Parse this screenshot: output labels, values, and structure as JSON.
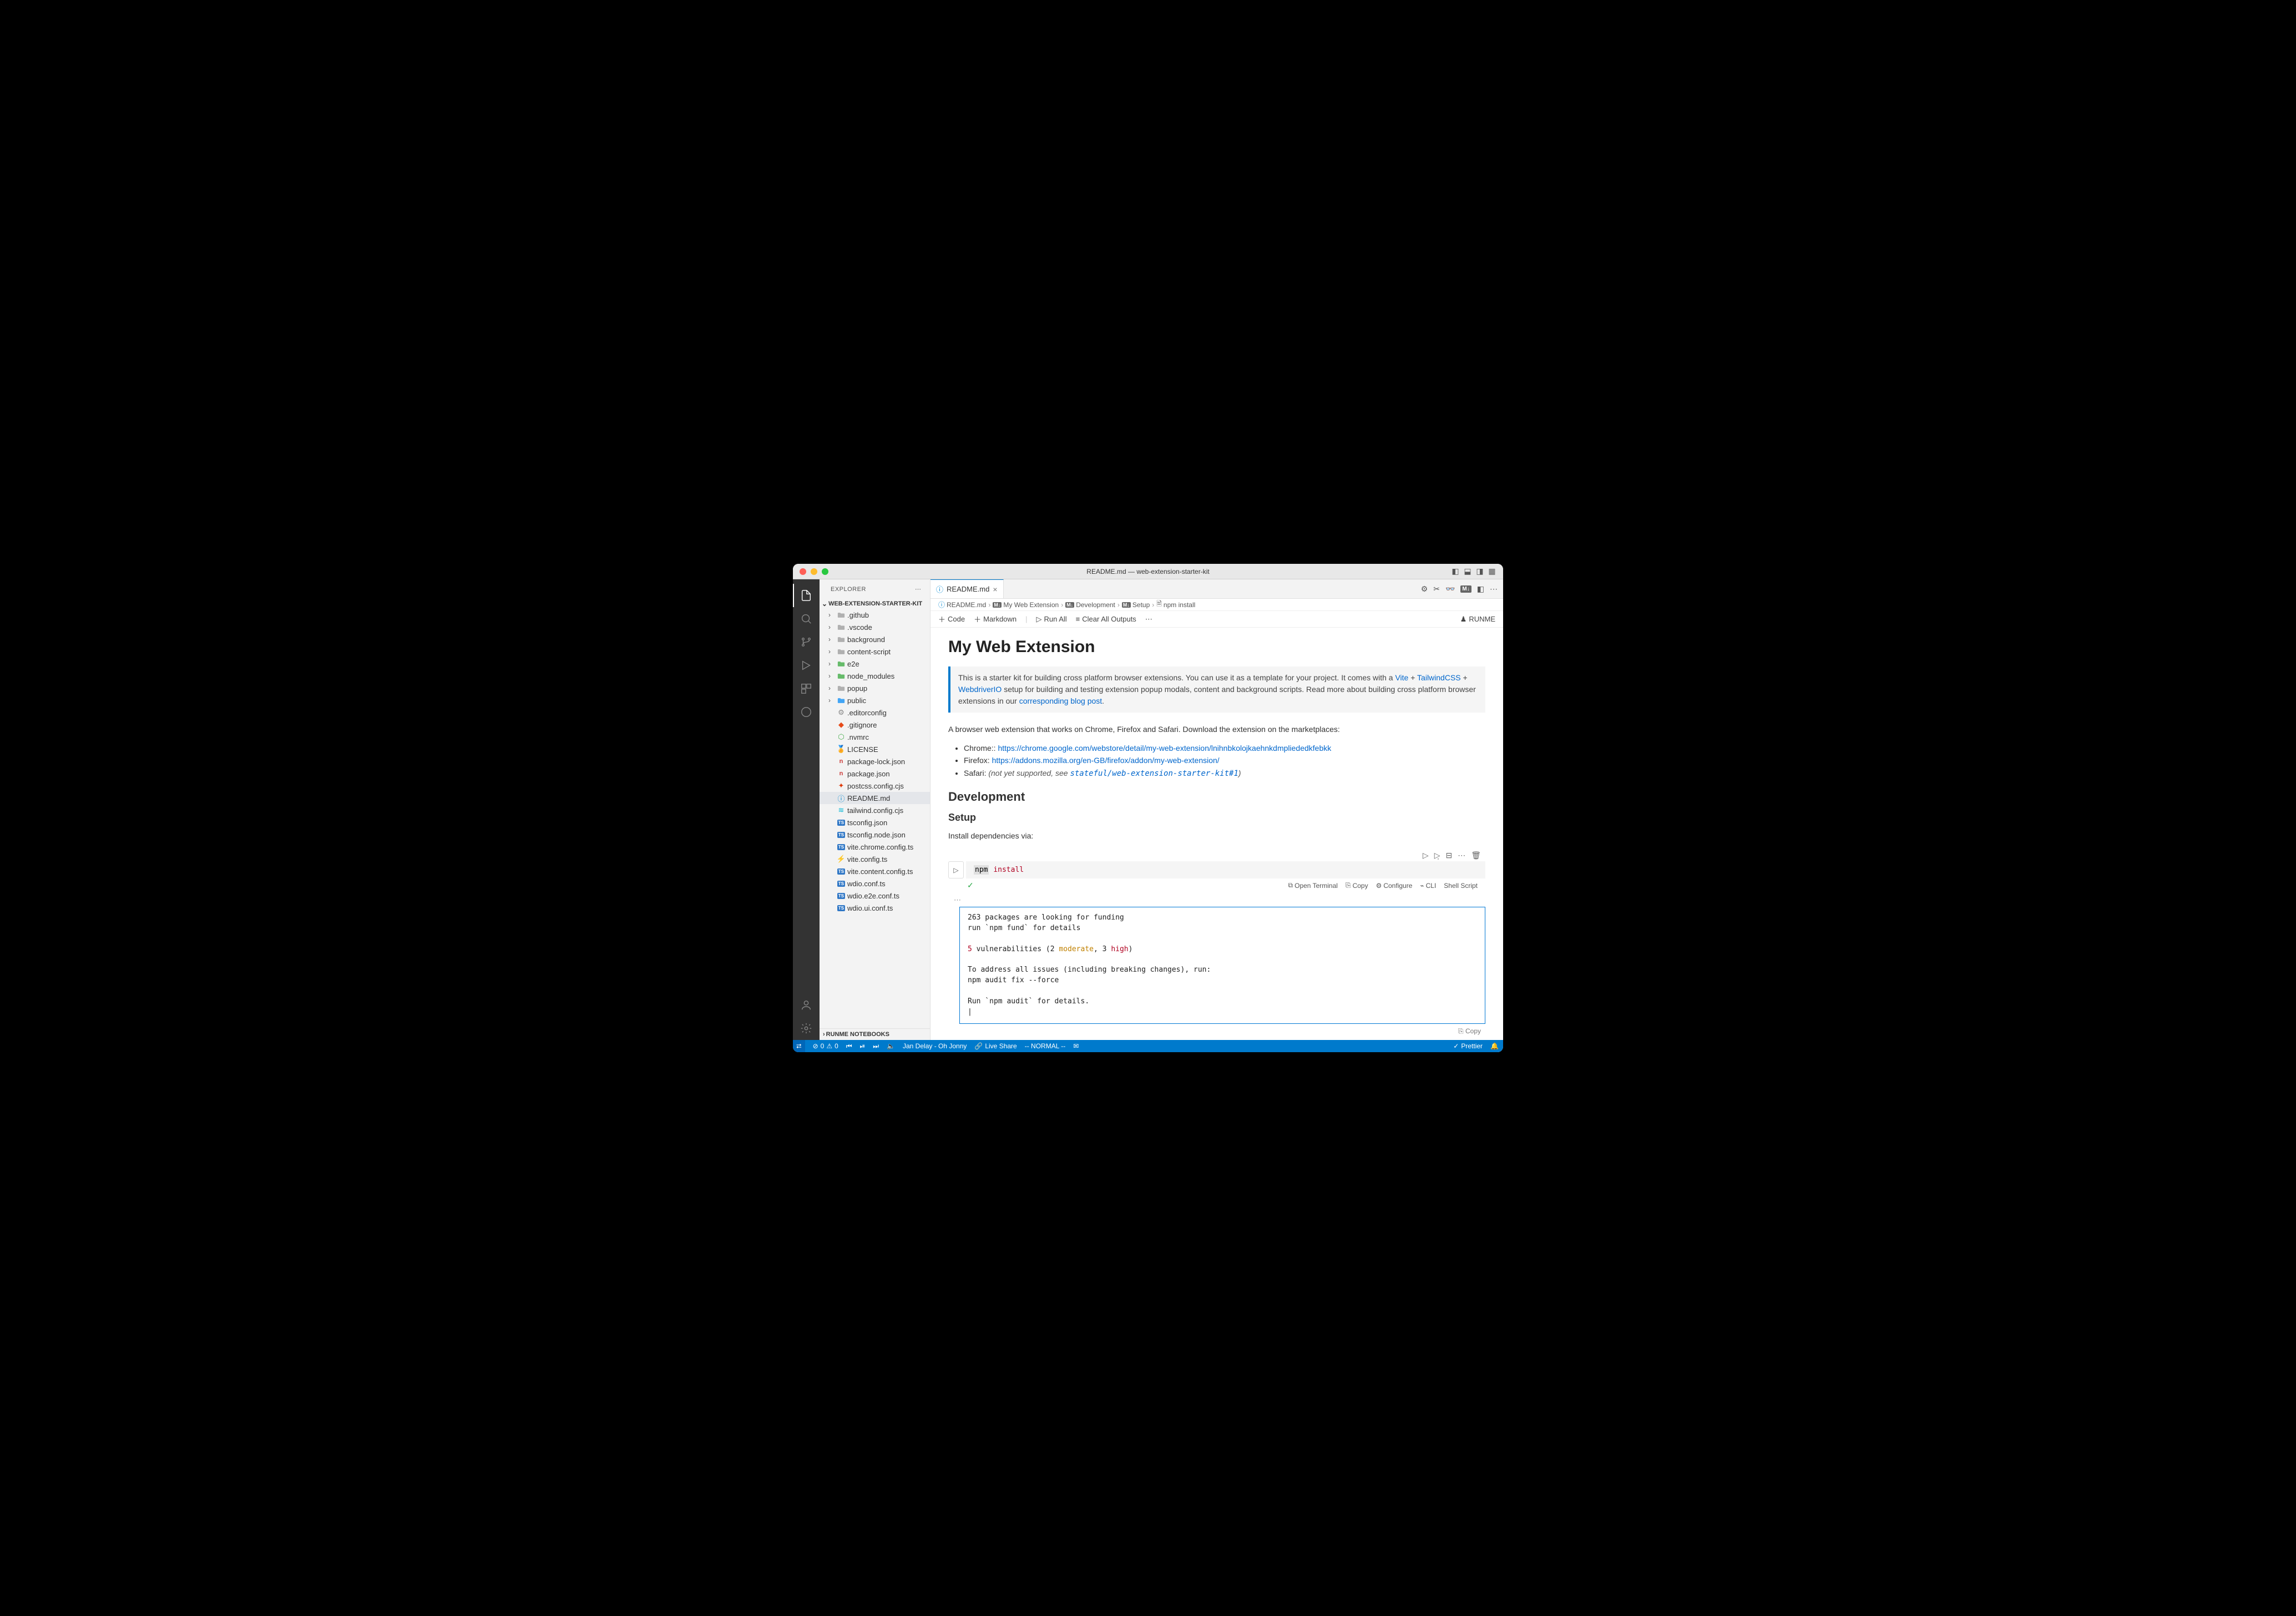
{
  "window": {
    "title": "README.md — web-extension-starter-kit"
  },
  "sidebar": {
    "title": "EXPLORER",
    "project": "WEB-EXTENSION-STARTER-KIT",
    "footer": "RUNME NOTEBOOKS",
    "tree": [
      {
        "type": "folder",
        "label": ".github",
        "color": "#b0b0b0"
      },
      {
        "type": "folder",
        "label": ".vscode",
        "color": "#b0b0b0"
      },
      {
        "type": "folder",
        "label": "background",
        "color": "#b0b0b0"
      },
      {
        "type": "folder",
        "label": "content-script",
        "color": "#b0b0b0"
      },
      {
        "type": "folder",
        "label": "e2e",
        "color": "#66bb6a"
      },
      {
        "type": "folder",
        "label": "node_modules",
        "color": "#66bb6a"
      },
      {
        "type": "folder",
        "label": "popup",
        "color": "#b0b0b0"
      },
      {
        "type": "folder",
        "label": "public",
        "color": "#42a5f5"
      },
      {
        "type": "file",
        "label": ".editorconfig",
        "icon": "gear"
      },
      {
        "type": "file",
        "label": ".gitignore",
        "icon": "git"
      },
      {
        "type": "file",
        "label": ".nvmrc",
        "icon": "hex"
      },
      {
        "type": "file",
        "label": "LICENSE",
        "icon": "cert"
      },
      {
        "type": "file",
        "label": "package-lock.json",
        "icon": "npm"
      },
      {
        "type": "file",
        "label": "package.json",
        "icon": "npm"
      },
      {
        "type": "file",
        "label": "postcss.config.cjs",
        "icon": "postcss"
      },
      {
        "type": "file",
        "label": "README.md",
        "icon": "info",
        "selected": true
      },
      {
        "type": "file",
        "label": "tailwind.config.cjs",
        "icon": "tw"
      },
      {
        "type": "file",
        "label": "tsconfig.json",
        "icon": "ts"
      },
      {
        "type": "file",
        "label": "tsconfig.node.json",
        "icon": "ts"
      },
      {
        "type": "file",
        "label": "vite.chrome.config.ts",
        "icon": "ts"
      },
      {
        "type": "file",
        "label": "vite.config.ts",
        "icon": "vite"
      },
      {
        "type": "file",
        "label": "vite.content.config.ts",
        "icon": "ts"
      },
      {
        "type": "file",
        "label": "wdio.conf.ts",
        "icon": "ts"
      },
      {
        "type": "file",
        "label": "wdio.e2e.conf.ts",
        "icon": "ts"
      },
      {
        "type": "file",
        "label": "wdio.ui.conf.ts",
        "icon": "ts"
      }
    ]
  },
  "tab": {
    "label": "README.md"
  },
  "tabs_right_md": "M↓",
  "breadcrumb": {
    "file": "README.md",
    "h1": "My Web Extension",
    "h2": "Development",
    "h3": "Setup",
    "cmd": "npm install"
  },
  "toolbar": {
    "code": "Code",
    "markdown": "Markdown",
    "run_all": "Run All",
    "clear": "Clear All Outputs",
    "runme": "RUNME"
  },
  "doc": {
    "h1": "My Web Extension",
    "callout_pre": "This is a starter kit for building cross platform browser extensions. You can use it as a template for your project. It comes with a ",
    "link_vite": "Vite",
    "plus": " + ",
    "link_tw": "TailwindCSS",
    "plus2": " + ",
    "link_wdio": "WebdriverIO",
    "callout_mid": " setup for building and testing extension popup modals, content and background scripts. Read more about building cross platform browser extensions in our ",
    "link_blog": "corresponding blog post",
    "dot": ".",
    "intro": "A browser web extension that works on Chrome, Firefox and Safari. Download the extension on the marketplaces:",
    "chrome_label": "Chrome:: ",
    "chrome_link": "https://chrome.google.com/webstore/detail/my-web-extension/lnihnbkolojkaehnkdmpliededkfebkk",
    "firefox_label": "Firefox: ",
    "firefox_link": "https://addons.mozilla.org/en-GB/firefox/addon/my-web-extension/",
    "safari_label": "Safari: ",
    "safari_note": "(not yet supported, see ",
    "safari_code": "stateful/web-extension-starter-kit#1",
    "safari_close": ")",
    "h2_dev": "Development",
    "h3_setup": "Setup",
    "install_text": "Install dependencies via:"
  },
  "cell": {
    "cmd": "npm",
    "arg": "install",
    "status": {
      "open_terminal": "Open Terminal",
      "copy": "Copy",
      "configure": "Configure",
      "cli": "CLI",
      "lang": "Shell Script"
    }
  },
  "output": {
    "l1": "263 packages are looking for funding",
    "l2": "  run `npm fund` for details",
    "l3a": "5",
    "l3b": " vulnerabilities (2 ",
    "l3c": "moderate",
    "l3d": ", 3 ",
    "l3e": "high",
    "l3f": ")",
    "l4": "To address all issues (including breaking changes), run:",
    "l5": "  npm audit fix --force",
    "l6": "Run `npm audit` for details.",
    "copy": "Copy"
  },
  "status": {
    "remote": "",
    "errors": "0",
    "warnings": "0",
    "music": "Jan Delay - Oh Jonny",
    "live": "Live Share",
    "mode": "-- NORMAL --",
    "prettier": "Prettier"
  }
}
